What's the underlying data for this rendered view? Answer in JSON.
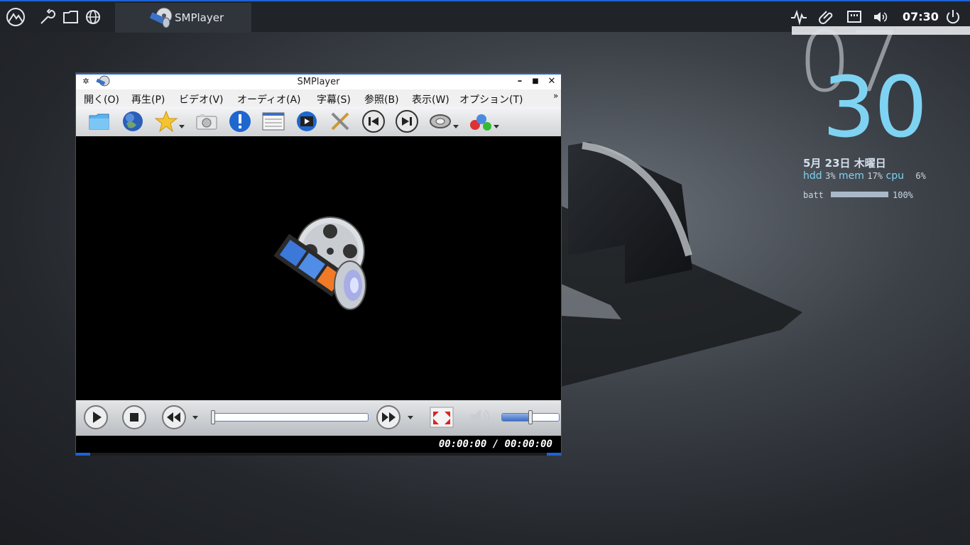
{
  "taskbar": {
    "launchers": [
      "mountain-logo-icon",
      "wrench-icon",
      "folder-icon",
      "globe-icon"
    ],
    "task": {
      "label": "SMPlayer"
    },
    "tray": [
      "activity-icon",
      "paperclip-icon",
      "network-icon",
      "volume-icon"
    ],
    "clock": "07:30",
    "power": "power-icon"
  },
  "conky": {
    "hour": "07",
    "minute": "30",
    "date": "5月 23日 木曜日",
    "hdd_label": "hdd",
    "hdd_value": "3%",
    "mem_label": "mem",
    "mem_value": "17%",
    "cpu_label": "cpu",
    "cpu_value": "6%",
    "batt_label": "batt",
    "batt_value": "100%",
    "batt_level": 1.0
  },
  "window": {
    "title": "SMPlayer",
    "menu": [
      "開く(O)",
      "再生(P)",
      "ビデオ(V)",
      "オーディオ(A)",
      "字幕(S)",
      "参照(B)",
      "表示(W)",
      "オプション(T)"
    ],
    "menu_more": "»",
    "timecode": "00:00:00 / 00:00:00",
    "seek_position": 0,
    "volume_level": 0.5
  },
  "colors": {
    "accent": "#1e63d6",
    "conky_cyan": "#7fd3f2",
    "video_bg": "#000000"
  }
}
